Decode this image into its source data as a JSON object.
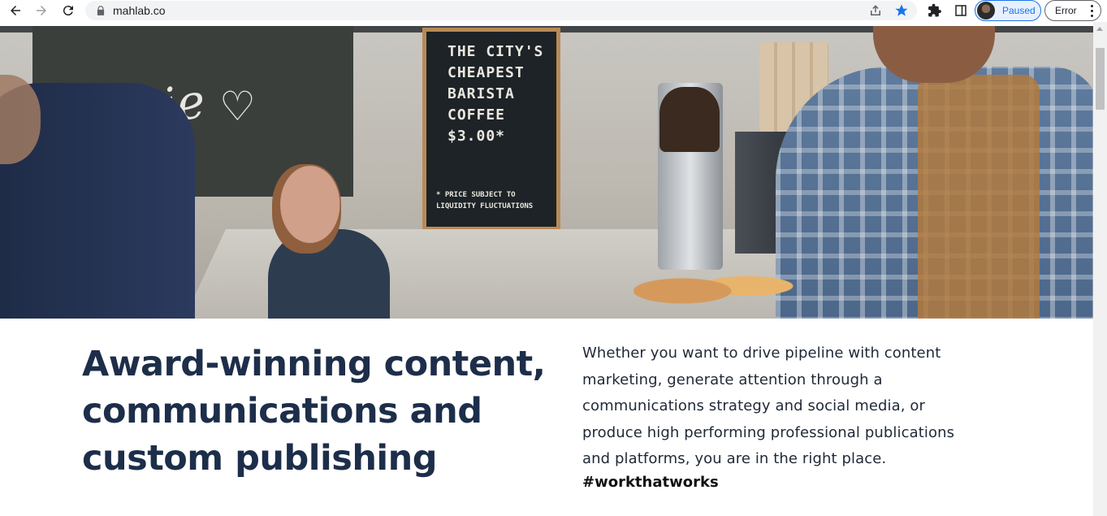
{
  "browser": {
    "url": "mahlab.co",
    "profile_label": "Paused",
    "error_label": "Error",
    "icons": {
      "back": "back-arrow-icon",
      "forward": "forward-arrow-icon",
      "reload": "reload-icon",
      "lock": "lock-icon",
      "share": "share-icon",
      "bookmark": "star-icon",
      "extensions": "puzzle-icon",
      "side_panel": "side-panel-icon",
      "menu": "kebab-menu-icon"
    },
    "colors": {
      "bookmark_star": "#1a73e8",
      "profile_accent": "#1a73e8"
    }
  },
  "hero": {
    "chalkboard_lines": [
      "THE CITY'S",
      "CHEAPEST",
      "BARISTA",
      "COFFEE",
      "$3.00*"
    ],
    "chalkboard_note": [
      "* PRICE SUBJECT TO",
      "LIQUIDITY FLUCTUATIONS"
    ],
    "wall_script": "grazie"
  },
  "content": {
    "headline_lines": [
      "Award-winning content,",
      "communications and",
      "custom publishing"
    ],
    "body_lines": [
      "Whether you want to drive pipeline with content",
      "marketing, generate attention through a",
      "communications strategy and social media, or",
      "produce high performing professional publications",
      "and platforms, you are in the right place."
    ],
    "hashtag": "#workthatworks",
    "colors": {
      "headline": "#1d2e4a"
    }
  }
}
